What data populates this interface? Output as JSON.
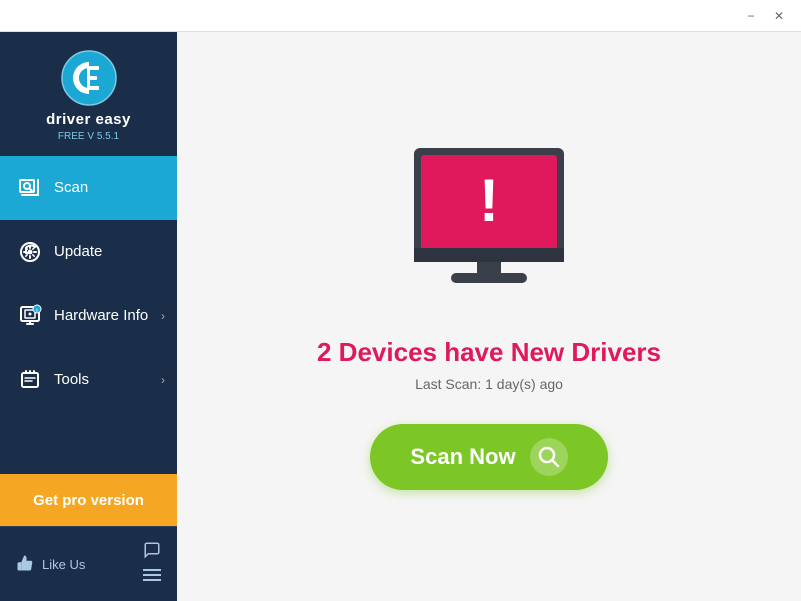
{
  "titlebar": {
    "minimize_label": "−",
    "close_label": "✕"
  },
  "sidebar": {
    "logo_text": "driver easy",
    "logo_version": "FREE V 5.5.1",
    "nav_items": [
      {
        "id": "scan",
        "label": "Scan",
        "active": true,
        "has_chevron": false
      },
      {
        "id": "update",
        "label": "Update",
        "active": false,
        "has_chevron": false
      },
      {
        "id": "hardware-info",
        "label": "Hardware Info",
        "active": false,
        "has_chevron": true
      },
      {
        "id": "tools",
        "label": "Tools",
        "active": false,
        "has_chevron": true
      }
    ],
    "pro_button_label": "Get pro version",
    "like_label": "Like Us"
  },
  "content": {
    "status_headline": "2 Devices have New Drivers",
    "last_scan_text": "Last Scan: 1 day(s) ago",
    "scan_button_label": "Scan Now"
  }
}
